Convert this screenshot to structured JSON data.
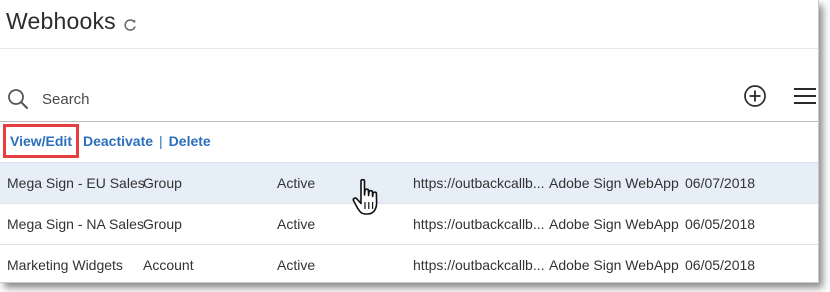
{
  "header": {
    "title": "Webhooks"
  },
  "search": {
    "placeholder": "Search",
    "value": ""
  },
  "actions": {
    "view_edit": "View/Edit",
    "deactivate": "Deactivate",
    "separator": "|",
    "delete": "Delete"
  },
  "table": {
    "rows": [
      {
        "name": "Mega Sign - EU Sales",
        "scope": "Group",
        "status": "Active",
        "url": "https://outbackcallb...",
        "application": "Adobe Sign WebApp",
        "date": "06/07/2018",
        "selected": true
      },
      {
        "name": "Mega Sign - NA Sales",
        "scope": "Group",
        "status": "Active",
        "url": "https://outbackcallb...",
        "application": "Adobe Sign WebApp",
        "date": "06/05/2018",
        "selected": false
      },
      {
        "name": "Marketing Widgets",
        "scope": "Account",
        "status": "Active",
        "url": "https://outbackcallb...",
        "application": "Adobe Sign WebApp",
        "date": "06/05/2018",
        "selected": false
      }
    ]
  },
  "icons": {
    "refresh": "refresh-icon",
    "search": "search-icon",
    "add": "add-circle-icon",
    "menu": "hamburger-menu-icon",
    "cursor": "hand-pointer-cursor-icon"
  },
  "colors": {
    "link": "#2c6fbc",
    "highlight_border": "#e5403f",
    "selected_row": "#e6eef7",
    "text": "#333333"
  }
}
